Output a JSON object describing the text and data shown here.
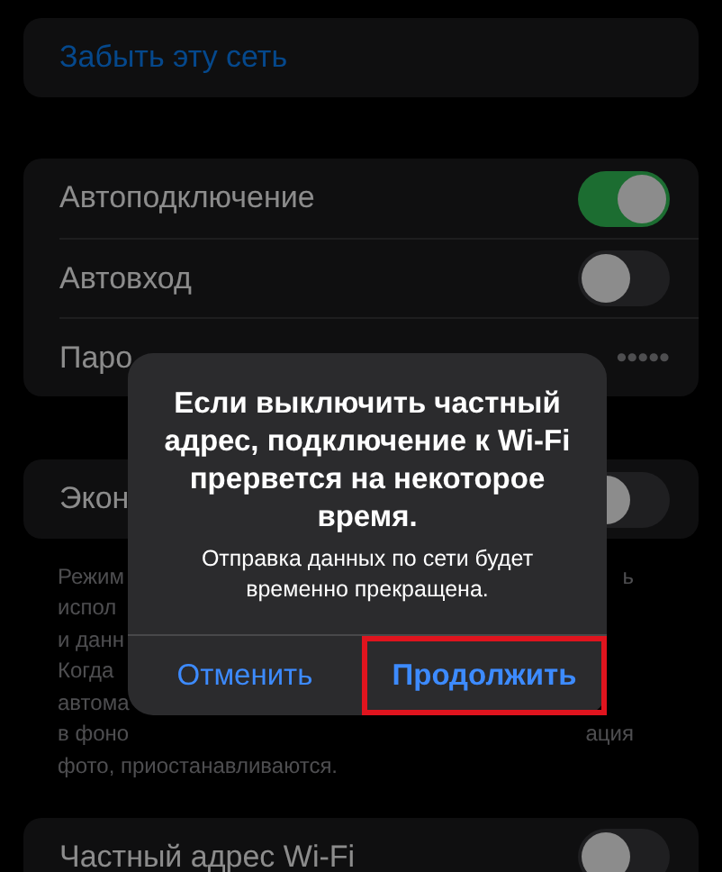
{
  "forget_network": {
    "label": "Забыть эту сеть"
  },
  "settings": [
    {
      "kind": "toggle",
      "label": "Автоподключение",
      "on": true
    },
    {
      "kind": "toggle",
      "label": "Автовход",
      "on": false
    },
    {
      "kind": "password",
      "label": "Паро",
      "value": "•••••"
    }
  ],
  "low_data": {
    "label": "Экон",
    "on": false
  },
  "footer_lines": [
    {
      "left": "Режим",
      "right": "ь"
    },
    {
      "left": "испол"
    },
    {
      "left": "и данн"
    },
    {
      "left": "Когда"
    },
    {
      "left": "автома"
    },
    {
      "left": "в фоно",
      "right": "ация"
    },
    {
      "left": "фото, приостанавливаются."
    }
  ],
  "private_address": {
    "label": "Частный адрес Wi-Fi",
    "on": false
  },
  "alert": {
    "title": "Если выключить частный адрес, подключение к Wi-Fi прервется на некоторое время.",
    "message": "Отправка данных по сети будет временно прекращена.",
    "buttons": [
      {
        "label": "Отменить",
        "highlighted": false
      },
      {
        "label": "Продолжить",
        "highlighted": true
      }
    ]
  }
}
